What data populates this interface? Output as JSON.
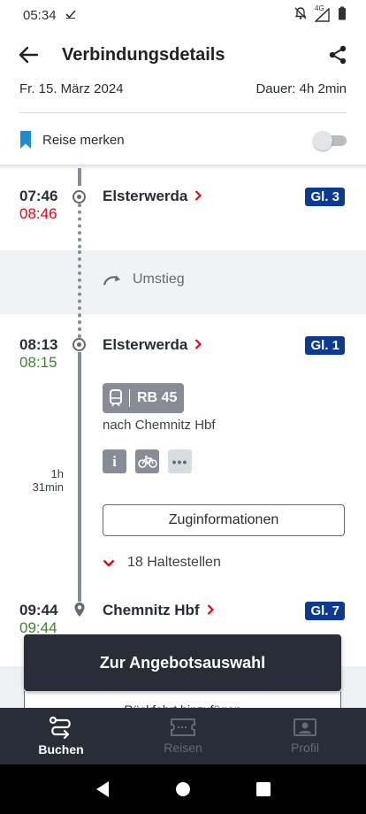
{
  "status_bar": {
    "time": "05:34",
    "network": "4G"
  },
  "header": {
    "title": "Verbindungsdetails"
  },
  "summary": {
    "date": "Fr. 15. März 2024",
    "duration": "Dauer: 4h 2min"
  },
  "bookmark": {
    "label": "Reise merken",
    "enabled": false
  },
  "stops": [
    {
      "scheduled": "07:46",
      "actual": "08:46",
      "station": "Elsterwerda",
      "track": "Gl. 3"
    },
    {
      "scheduled": "08:13",
      "actual": "08:15",
      "station": "Elsterwerda",
      "track": "Gl. 1"
    },
    {
      "scheduled": "09:44",
      "actual": "09:44",
      "station": "Chemnitz Hbf",
      "track": "Gl. 7"
    }
  ],
  "transfer": {
    "label": "Umstieg"
  },
  "leg": {
    "train": "RB 45",
    "direction": "nach Chemnitz Hbf",
    "duration_hours": "1h",
    "duration_minutes": "31min",
    "info_button": "Zuginformationen",
    "stops_toggle": "18 Haltestellen",
    "amenities": [
      "info-icon",
      "bicycle-icon",
      "more-icon"
    ]
  },
  "cta": {
    "primary": "Zur Angebotsauswahl",
    "secondary_partial": "Rückfahrt hinzufügen"
  },
  "bottom_nav": [
    {
      "label": "Buchen",
      "active": true
    },
    {
      "label": "Reisen",
      "active": false
    },
    {
      "label": "Profil",
      "active": false
    }
  ],
  "colors": {
    "accent_red": "#ec0016",
    "on_time_green": "#408335",
    "track_blue": "#0c3992",
    "dark": "#282d37"
  }
}
